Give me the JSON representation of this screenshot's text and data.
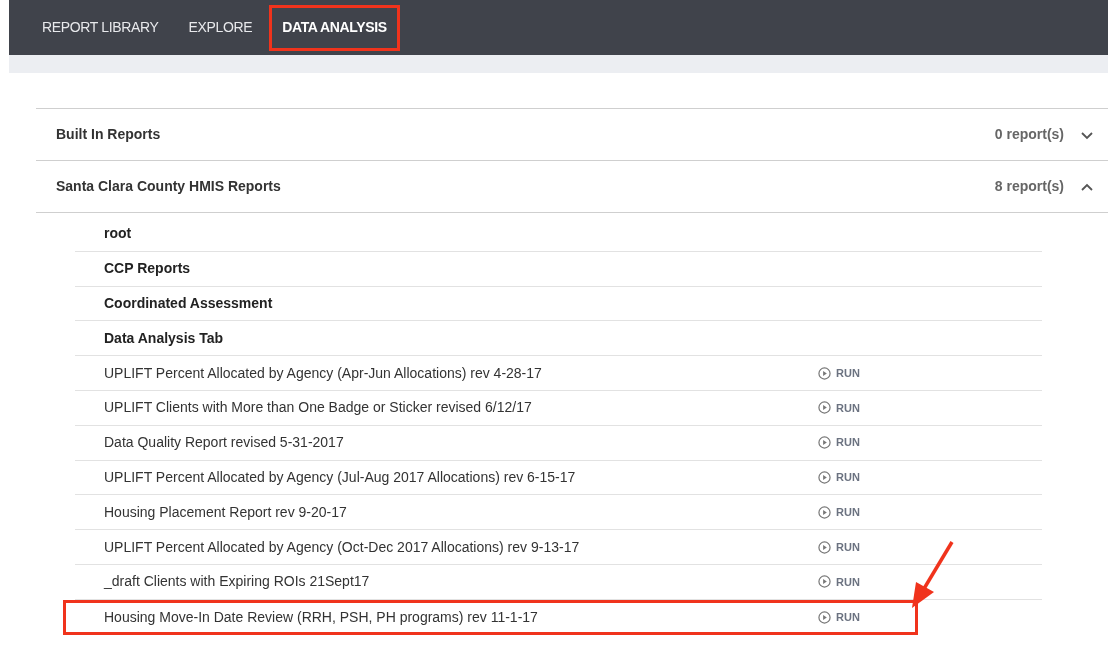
{
  "nav": {
    "tabs": [
      {
        "label": "REPORT LIBRARY",
        "selected": false,
        "highlighted": false
      },
      {
        "label": "EXPLORE",
        "selected": false,
        "highlighted": false
      },
      {
        "label": "DATA ANALYSIS",
        "selected": true,
        "highlighted": true
      }
    ]
  },
  "sections": [
    {
      "title": "Built In Reports",
      "count": "0 report(s)",
      "expanded": false
    },
    {
      "title": "Santa Clara County HMIS Reports",
      "count": "8 report(s)",
      "expanded": true,
      "items": [
        {
          "kind": "folder",
          "name": "root"
        },
        {
          "kind": "folder",
          "name": "CCP Reports"
        },
        {
          "kind": "folder",
          "name": "Coordinated Assessment"
        },
        {
          "kind": "folder",
          "name": "Data Analysis Tab"
        },
        {
          "kind": "report",
          "name": "UPLIFT Percent Allocated by Agency (Apr-Jun Allocations) rev 4-28-17",
          "action": "RUN",
          "highlighted": false
        },
        {
          "kind": "report",
          "name": "UPLIFT Clients with More than One Badge or Sticker revised 6/12/17",
          "action": "RUN",
          "highlighted": false
        },
        {
          "kind": "report",
          "name": "Data Quality Report revised 5-31-2017",
          "action": "RUN",
          "highlighted": false
        },
        {
          "kind": "report",
          "name": "UPLIFT Percent Allocated by Agency (Jul-Aug 2017 Allocations) rev 6-15-17",
          "action": "RUN",
          "highlighted": false
        },
        {
          "kind": "report",
          "name": "Housing Placement Report rev 9-20-17",
          "action": "RUN",
          "highlighted": false
        },
        {
          "kind": "report",
          "name": "UPLIFT Percent Allocated by Agency (Oct-Dec 2017 Allocations) rev 9-13-17",
          "action": "RUN",
          "highlighted": false
        },
        {
          "kind": "report",
          "name": "_draft Clients with Expiring ROIs 21Sept17",
          "action": "RUN",
          "highlighted": false
        },
        {
          "kind": "report",
          "name": "Housing Move-In Date Review (RRH, PSH, PH programs) rev 11-1-17",
          "action": "RUN",
          "highlighted": true
        }
      ]
    }
  ]
}
